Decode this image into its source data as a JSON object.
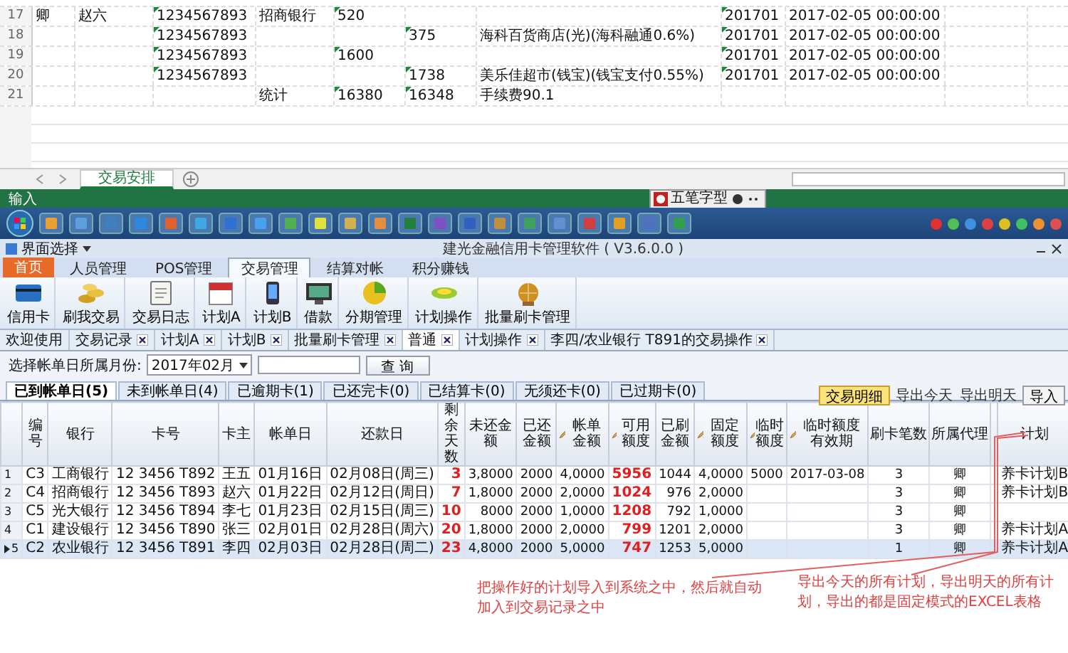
{
  "spreadsheet": {
    "rows": [
      {
        "number": "17",
        "cells": [
          {
            "text": "卿",
            "flag": false
          },
          {
            "text": "赵六",
            "flag": false
          },
          {
            "text": "1234567893",
            "flag": true
          },
          {
            "text": "招商银行",
            "flag": false
          },
          {
            "text": "520",
            "flag": true
          },
          null,
          null,
          {
            "text": "201701",
            "flag": true
          },
          {
            "text": "2017-02-05 00:00:00",
            "flag": false
          },
          null,
          null
        ]
      },
      {
        "number": "18",
        "cells": [
          null,
          null,
          {
            "text": "1234567893",
            "flag": true
          },
          null,
          null,
          {
            "text": "375",
            "flag": true
          },
          {
            "text": "海科百货商店(光)(海科融通0.6%)",
            "flag": false
          },
          {
            "text": "201701",
            "flag": true
          },
          {
            "text": "2017-02-05 00:00:00",
            "flag": false
          },
          null,
          null
        ]
      },
      {
        "number": "19",
        "cells": [
          null,
          null,
          {
            "text": "1234567893",
            "flag": true
          },
          null,
          {
            "text": "1600",
            "flag": true
          },
          null,
          null,
          {
            "text": "201701",
            "flag": true
          },
          {
            "text": "2017-02-05 00:00:00",
            "flag": false
          },
          null,
          null
        ]
      },
      {
        "number": "20",
        "cells": [
          null,
          null,
          {
            "text": "1234567893",
            "flag": true
          },
          null,
          null,
          {
            "text": "1738",
            "flag": true
          },
          {
            "text": "美乐佳超市(钱宝)(钱宝支付0.55%)",
            "flag": false
          },
          {
            "text": "201701",
            "flag": true
          },
          {
            "text": "2017-02-05 00:00:00",
            "flag": false
          },
          null,
          null
        ]
      },
      {
        "number": "21",
        "cells": [
          null,
          null,
          null,
          {
            "text": "统计",
            "flag": false
          },
          {
            "text": "16380",
            "flag": true
          },
          {
            "text": "16348",
            "flag": true
          },
          {
            "text": "手续费90.1",
            "flag": false
          },
          null,
          null,
          null,
          null
        ]
      }
    ],
    "sheet_tabs": [
      {
        "label": "交易安排",
        "selected": true
      }
    ],
    "status_bar": "输入"
  },
  "ime_bar": {
    "label": "五笔字型"
  },
  "app": {
    "menu": "界面选择",
    "title": "建光金融信用卡管理软件 ( V3.6.0.0 )",
    "home_button": "首页",
    "ribbon_tabs": [
      {
        "label": "人员管理",
        "selected": false
      },
      {
        "label": "POS管理",
        "selected": false
      },
      {
        "label": "交易管理",
        "selected": true
      },
      {
        "label": "结算对帐",
        "selected": false
      },
      {
        "label": "积分赚钱",
        "selected": false
      }
    ],
    "toolbar": [
      {
        "label": "信用卡"
      },
      {
        "label": "刷我交易"
      },
      {
        "label": "交易日志"
      },
      {
        "label": "计划A"
      },
      {
        "label": "计划B"
      },
      {
        "label": "借款"
      },
      {
        "label": "分期管理"
      },
      {
        "label": "计划操作"
      },
      {
        "label": "批量刷卡管理"
      }
    ],
    "doc_tabs": [
      {
        "label": "欢迎使用",
        "closable": false,
        "selected": false
      },
      {
        "label": "交易记录",
        "closable": true,
        "selected": false
      },
      {
        "label": "计划A",
        "closable": true,
        "selected": false
      },
      {
        "label": "计划B",
        "closable": true,
        "selected": false
      },
      {
        "label": "批量刷卡管理",
        "closable": true,
        "selected": false
      },
      {
        "label": "普通",
        "closable": true,
        "selected": true
      },
      {
        "label": "计划操作",
        "closable": true,
        "selected": false
      },
      {
        "label": "李四/农业银行 T891的交易操作",
        "closable": true,
        "selected": false
      }
    ],
    "filter": {
      "label": "选择帐单日所属月份:",
      "month": "2017年02月",
      "button": "查 询"
    },
    "status_tabs": [
      {
        "label": "已到帐单日(5)",
        "selected": true
      },
      {
        "label": "未到帐单日(4)",
        "selected": false
      },
      {
        "label": "已逾期卡(1)",
        "selected": false
      },
      {
        "label": "已还完卡(0)",
        "selected": false
      },
      {
        "label": "已结算卡(0)",
        "selected": false
      },
      {
        "label": "无须还卡(0)",
        "selected": false
      },
      {
        "label": "已过期卡(0)",
        "selected": false
      }
    ],
    "side_buttons": [
      {
        "label": "交易明细",
        "kind": "primary"
      },
      {
        "label": "导出今天",
        "kind": "link"
      },
      {
        "label": "导出明天",
        "kind": "link"
      },
      {
        "label": "导入",
        "kind": "plain"
      }
    ],
    "table": {
      "columns": [
        {
          "label": "编号",
          "kind": "text",
          "editable": false
        },
        {
          "label": "银行",
          "kind": "text",
          "editable": false
        },
        {
          "label": "卡号",
          "kind": "text",
          "editable": false
        },
        {
          "label": "卡主",
          "kind": "text",
          "editable": false
        },
        {
          "label": "帐单日",
          "kind": "text",
          "editable": false
        },
        {
          "label": "还款日",
          "kind": "text",
          "editable": false
        },
        {
          "label": "剩余天数",
          "kind": "alert",
          "editable": false
        },
        {
          "label": "未还金额",
          "kind": "number",
          "editable": false
        },
        {
          "label": "已还金额",
          "kind": "number",
          "editable": false
        },
        {
          "label": "帐单金额",
          "kind": "number",
          "editable": true
        },
        {
          "label": "可用额度",
          "kind": "alert",
          "editable": true
        },
        {
          "label": "已刷金额",
          "kind": "number",
          "editable": false
        },
        {
          "label": "固定额度",
          "kind": "number",
          "editable": true
        },
        {
          "label": "临时额度",
          "kind": "number",
          "editable": true
        },
        {
          "label": "临时额度有效期",
          "kind": "center",
          "editable": true
        },
        {
          "label": "刷卡笔数",
          "kind": "center",
          "editable": false
        },
        {
          "label": "所属代理",
          "kind": "center",
          "editable": false
        },
        {
          "kind": "text",
          "editable": false
        },
        {
          "label": "计划",
          "kind": "text",
          "editable": false
        }
      ],
      "rows": [
        {
          "number": "1",
          "selected": false,
          "cells": [
            "C3",
            "工商银行",
            "12 3456 T892",
            "王五",
            "01月16日",
            "02月08日(周三)",
            "3",
            "3,8000",
            "2000",
            "4,0000",
            "5956",
            "1044",
            "4,0000",
            "5000",
            "2017-03-08",
            "3",
            "卿",
            null,
            "养卡计划B"
          ]
        },
        {
          "number": "2",
          "selected": false,
          "cells": [
            "C4",
            "招商银行",
            "12 3456 T893",
            "赵六",
            "01月22日",
            "02月12日(周日)",
            "7",
            "1,8000",
            "2000",
            "2,0000",
            "1024",
            "976",
            "2,0000",
            null,
            null,
            "3",
            "卿",
            null,
            "养卡计划B"
          ]
        },
        {
          "number": "3",
          "selected": false,
          "cells": [
            "C5",
            "光大银行",
            "12 3456 T894",
            "李七",
            "01月23日",
            "02月15日(周三)",
            "10",
            "8000",
            "2000",
            "1,0000",
            "1208",
            "792",
            "1,0000",
            null,
            null,
            "3",
            "卿",
            null,
            null
          ]
        },
        {
          "number": "4",
          "selected": false,
          "cells": [
            "C1",
            "建设银行",
            "12 3456 T890",
            "张三",
            "02月01日",
            "02月28日(周六)",
            "20",
            "1,8000",
            "2000",
            "2,0000",
            "799",
            "1201",
            "2,0000",
            null,
            null,
            "3",
            "卿",
            null,
            "养卡计划A"
          ]
        },
        {
          "number": "5",
          "selected": true,
          "cells": [
            "C2",
            "农业银行",
            "12 3456 T891",
            "李四",
            "02月03日",
            "02月28日(周二)",
            "23",
            "4,8000",
            "2000",
            "5,0000",
            "747",
            "1253",
            "5,0000",
            null,
            null,
            "1",
            "卿",
            null,
            "养卡计划A"
          ]
        }
      ]
    }
  },
  "annotations": [
    {
      "text": "把操作好的计划导入到系统之中，然后就自动加入到交易记录之中"
    },
    {
      "text": "导出今天的所有计划，导出明天的所有计划，导出的都是固定模式的EXCEL表格"
    }
  ]
}
